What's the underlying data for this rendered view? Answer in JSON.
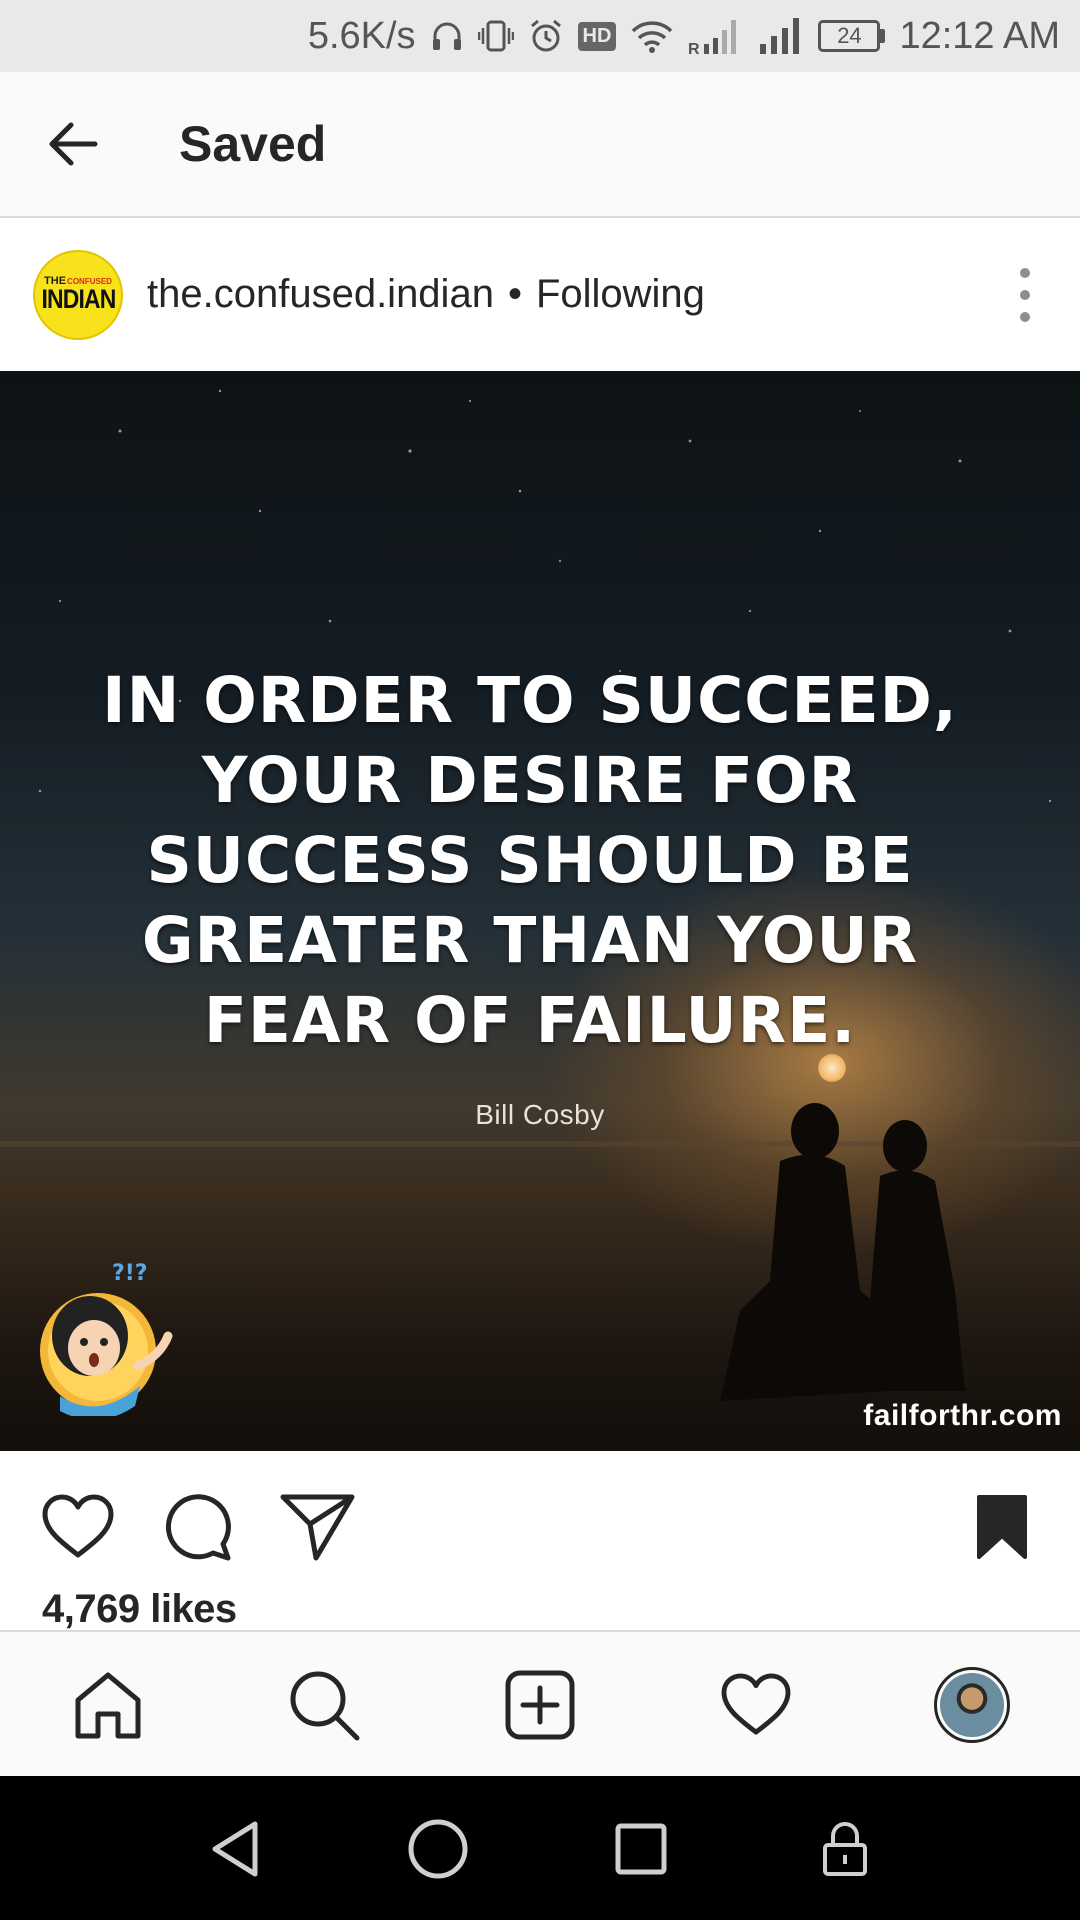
{
  "status_bar": {
    "net_speed": "5.6K/s",
    "hd_badge": "HD",
    "signal_sub": "R",
    "battery": "24",
    "time": "12:12 AM"
  },
  "header": {
    "title": "Saved",
    "back_icon": "arrow-left-icon"
  },
  "post": {
    "avatar": {
      "line1_the": "THE",
      "line1_confused": "CONFUSED",
      "line2": "INDIAN"
    },
    "username": "the.confused.indian",
    "separator": "•",
    "follow_status": "Following",
    "image": {
      "quote": "IN ORDER TO SUCCEED, YOUR DESIRE FOR SUCCESS SHOULD BE GREATER THAN YOUR FEAR OF FAILURE.",
      "author": "Bill Cosby",
      "watermark": "failforthr.com",
      "mascot_text": "?!?"
    },
    "likes": "4,769 likes",
    "saved": true
  },
  "icons": {
    "like": "heart-outline-icon",
    "comment": "speech-bubble-icon",
    "share": "paper-plane-icon",
    "save": "bookmark-filled-icon",
    "more": "three-dots-vertical-icon"
  },
  "bottom_nav": [
    "home",
    "search",
    "new-post",
    "activity",
    "profile"
  ],
  "colors": {
    "text": "#262626",
    "status_bar_bg": "#e9e9e9",
    "header_bg": "#fafafa",
    "avatar_bg": "#f7e21c",
    "system_nav_bg": "#000000"
  }
}
